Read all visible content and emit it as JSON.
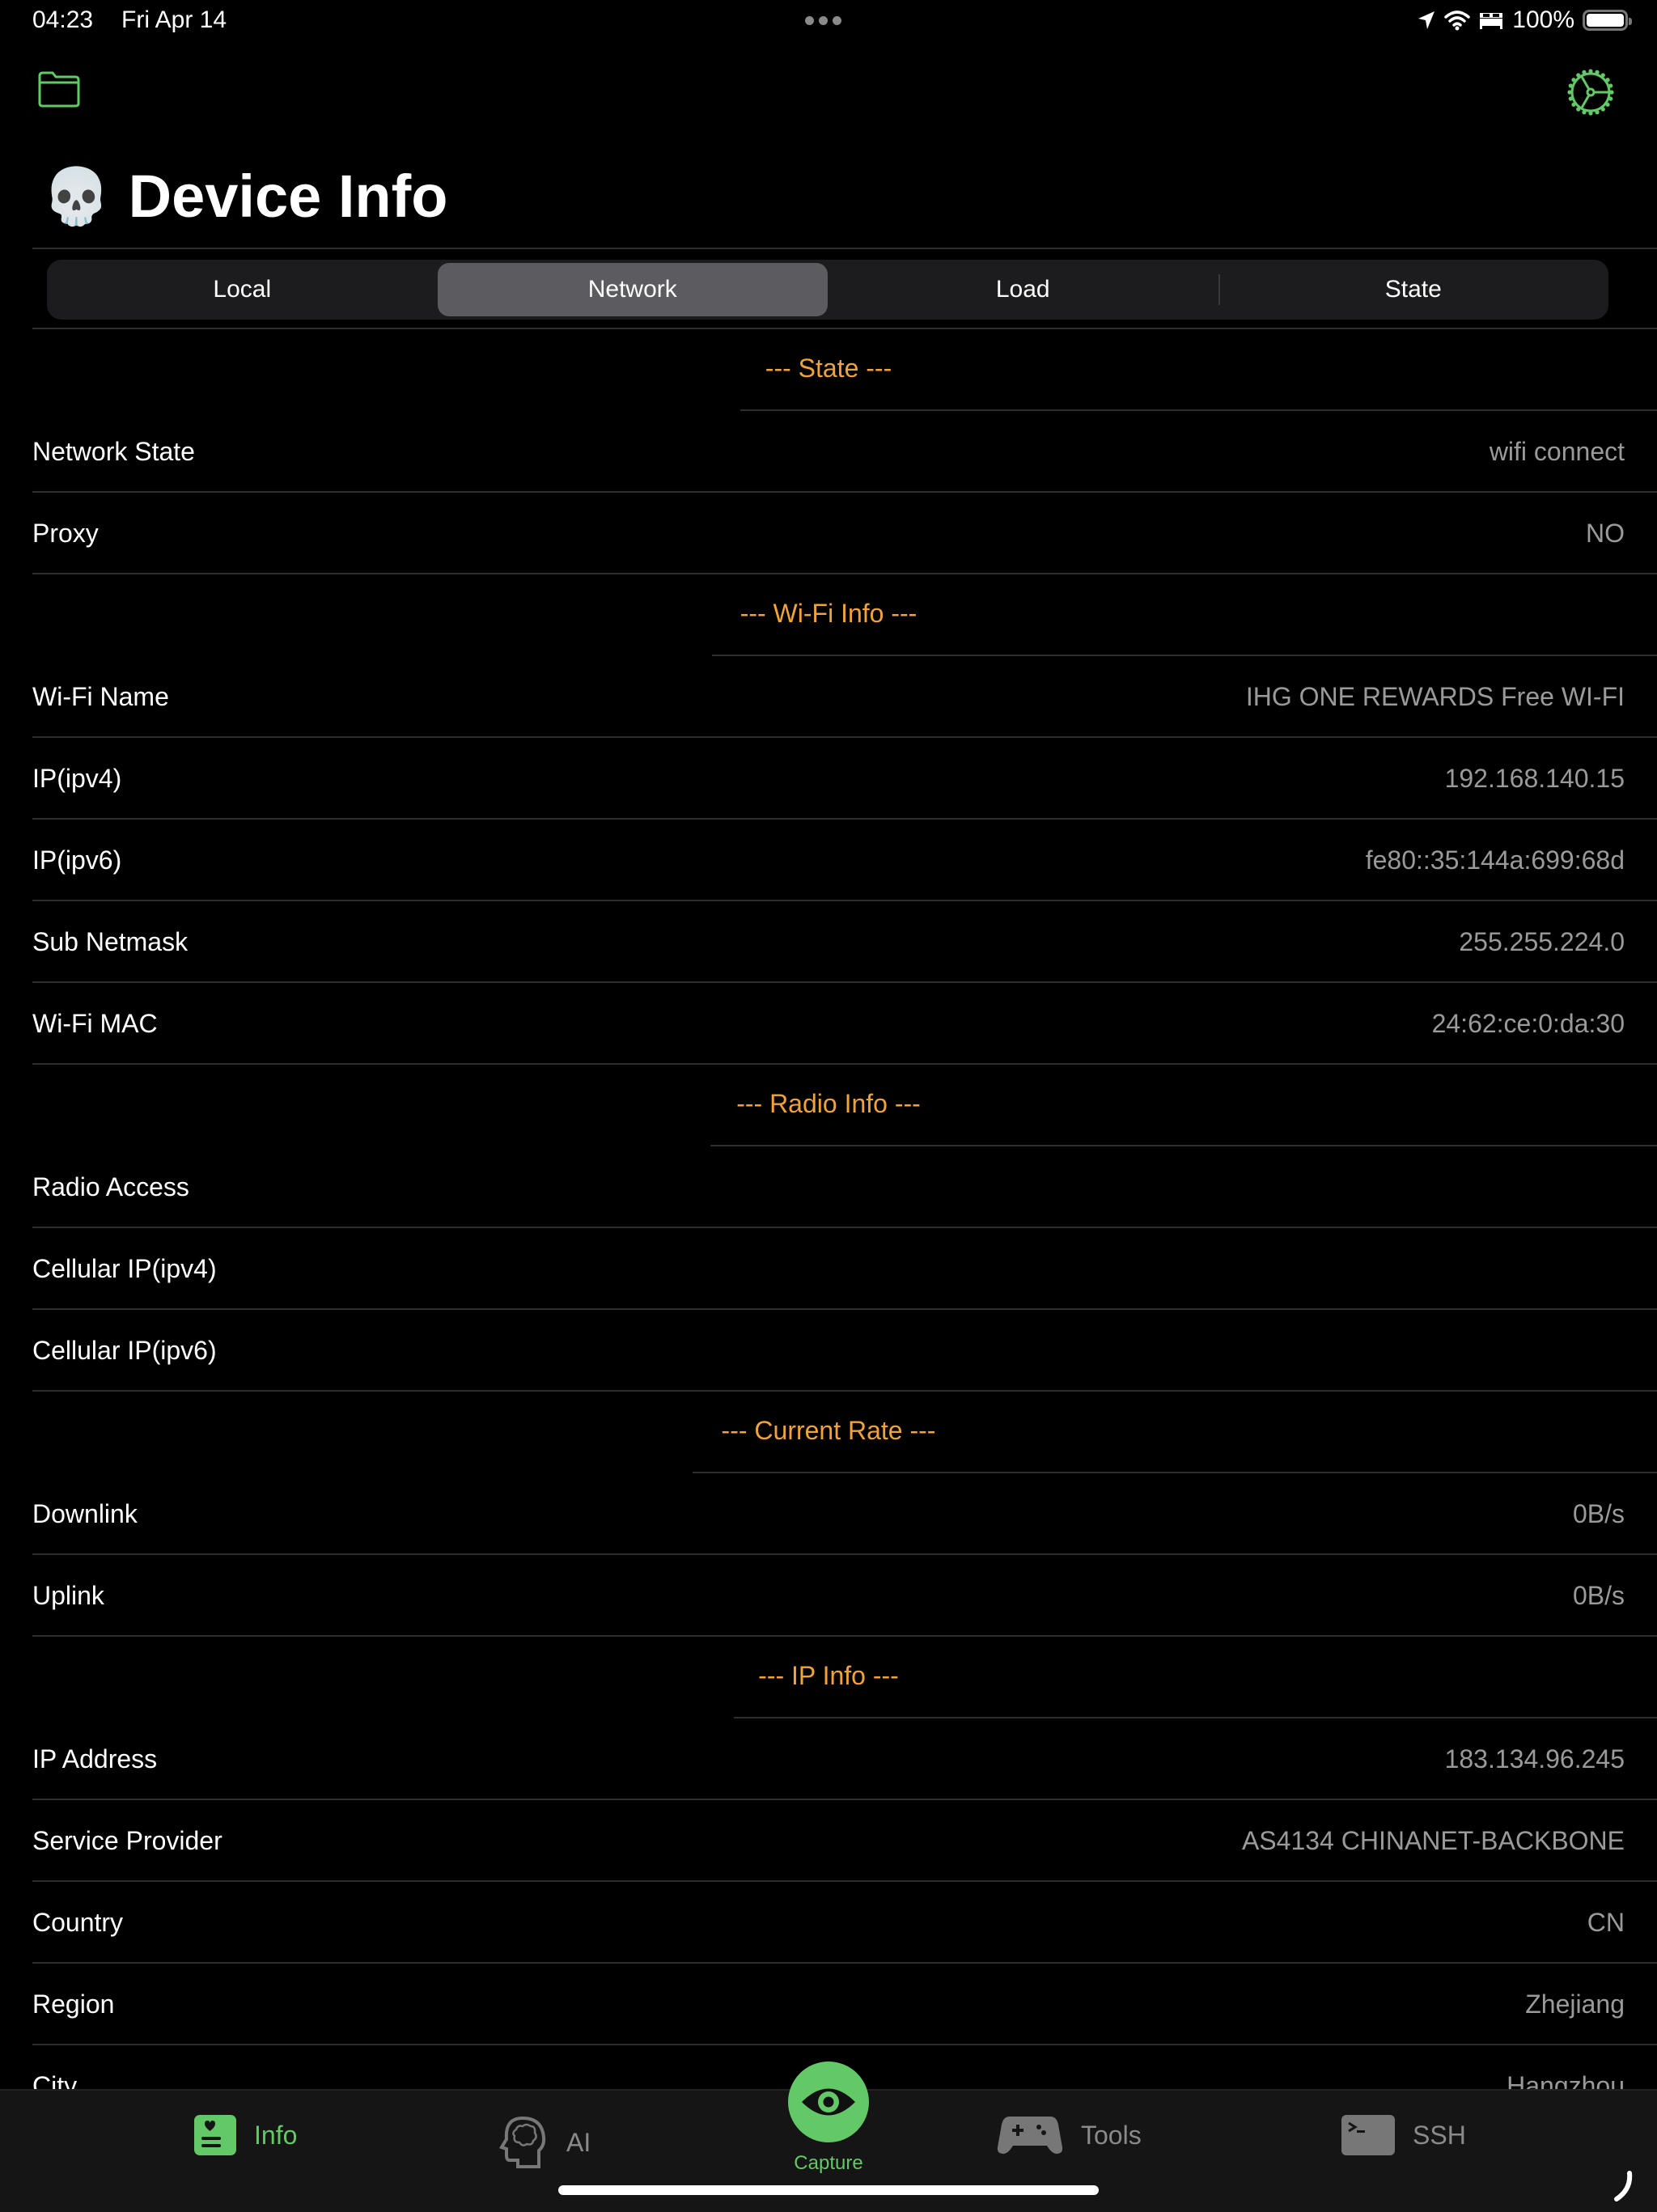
{
  "status_bar": {
    "time": "04:23",
    "date": "Fri Apr 14",
    "battery_percent": "100%",
    "battery_level": 1.0,
    "icons": [
      "location-arrow-icon",
      "wifi-icon",
      "bed-icon",
      "battery-icon"
    ]
  },
  "header": {
    "emoji": "💀",
    "title": "Device Info",
    "left_icon": "folder-icon",
    "right_icon": "gear-icon"
  },
  "tabs": {
    "items": [
      {
        "label": "Local",
        "selected": false
      },
      {
        "label": "Network",
        "selected": true
      },
      {
        "label": "Load",
        "selected": false
      },
      {
        "label": "State",
        "selected": false
      }
    ]
  },
  "sections": [
    {
      "title": "---  State  ---",
      "rows": [
        {
          "label": "Network State",
          "value": "wifi connect"
        },
        {
          "label": "Proxy",
          "value": "NO"
        }
      ]
    },
    {
      "title": "---  Wi-Fi Info  ---",
      "rows": [
        {
          "label": "Wi-Fi Name",
          "value": "IHG ONE REWARDS Free WI-FI"
        },
        {
          "label": "IP(ipv4)",
          "value": "192.168.140.15"
        },
        {
          "label": "IP(ipv6)",
          "value": "fe80::35:144a:699:68d"
        },
        {
          "label": "Sub Netmask",
          "value": "255.255.224.0"
        },
        {
          "label": "Wi-Fi MAC",
          "value": "24:62:ce:0:da:30"
        }
      ]
    },
    {
      "title": "---  Radio Info  ---",
      "rows": [
        {
          "label": "Radio Access",
          "value": ""
        },
        {
          "label": "Cellular IP(ipv4)",
          "value": ""
        },
        {
          "label": "Cellular IP(ipv6)",
          "value": ""
        }
      ]
    },
    {
      "title": "---  Current Rate  ---",
      "rows": [
        {
          "label": "Downlink",
          "value": "0B/s"
        },
        {
          "label": "Uplink",
          "value": "0B/s"
        }
      ]
    },
    {
      "title": "---  IP Info  ---",
      "rows": [
        {
          "label": "IP Address",
          "value": "183.134.96.245"
        },
        {
          "label": "Service Provider",
          "value": "AS4134 CHINANET-BACKBONE"
        },
        {
          "label": "Country",
          "value": "CN"
        },
        {
          "label": "Region",
          "value": "Zhejiang"
        },
        {
          "label": "City",
          "value": "Hangzhou"
        }
      ]
    }
  ],
  "tab_bar": {
    "items": [
      {
        "label": "Info",
        "icon": "info-card-icon",
        "active": true
      },
      {
        "label": "AI",
        "icon": "brain-head-icon",
        "active": false
      },
      {
        "label": "Capture",
        "icon": "eye-icon",
        "active": true
      },
      {
        "label": "Tools",
        "icon": "gamepad-icon",
        "active": false
      },
      {
        "label": "SSH",
        "icon": "terminal-icon",
        "active": false
      }
    ]
  },
  "colors": {
    "accent_green": "#62c966",
    "section_orange": "#f0a33a",
    "value_gray": "#9a9a9a",
    "background": "#000000"
  }
}
